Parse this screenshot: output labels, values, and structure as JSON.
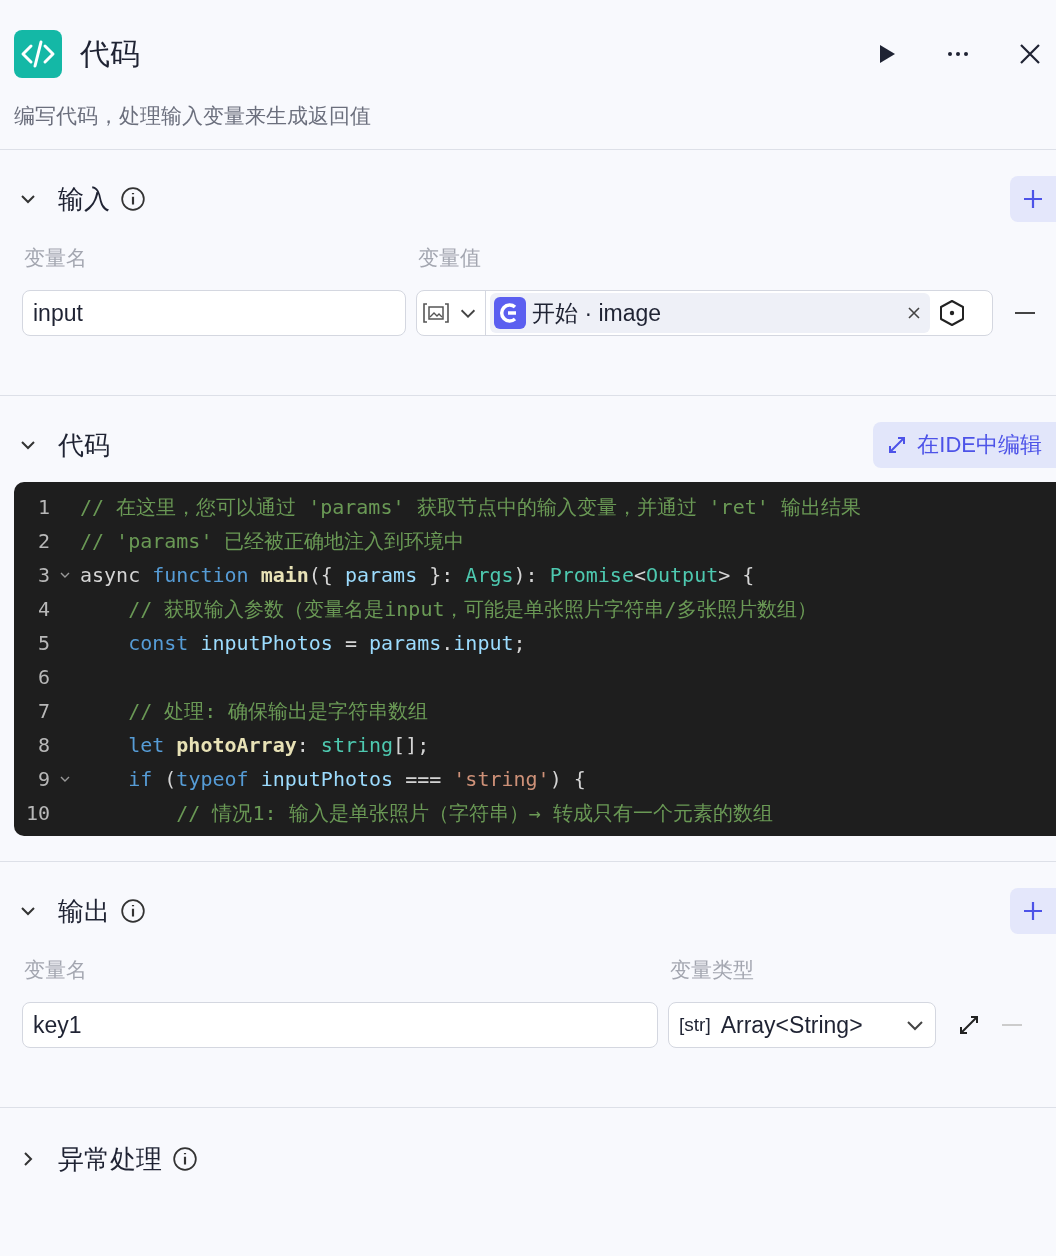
{
  "header": {
    "title": "代码",
    "description": "编写代码，处理输入变量来生成返回值"
  },
  "input_section": {
    "title": "输入",
    "expanded": true,
    "columns": [
      "变量名",
      "变量值"
    ],
    "rows": [
      {
        "name": "input",
        "kind": "image",
        "ref_source": "开始 · image"
      }
    ]
  },
  "code_section": {
    "title": "代码",
    "expanded": true,
    "ide_button": "在IDE中编辑",
    "lines": [
      {
        "number": "1",
        "foldable": false,
        "tokens": [
          {
            "kind": "comment",
            "text": "// 在这里，您可以通过 'params' 获取节点中的输入变量，并通过 'ret' 输出结果"
          }
        ]
      },
      {
        "number": "2",
        "foldable": false,
        "tokens": [
          {
            "kind": "comment",
            "text": "// 'params' 已经被正确地注入到环境中"
          }
        ]
      },
      {
        "number": "3",
        "foldable": true,
        "tokens": [
          {
            "kind": "plain",
            "text": "async "
          },
          {
            "kind": "keyword",
            "text": "function "
          },
          {
            "kind": "func",
            "text": "main"
          },
          {
            "kind": "plain",
            "text": "({ "
          },
          {
            "kind": "var",
            "text": "params"
          },
          {
            "kind": "plain",
            "text": " }: "
          },
          {
            "kind": "type",
            "text": "Args"
          },
          {
            "kind": "plain",
            "text": "): "
          },
          {
            "kind": "type",
            "text": "Promise"
          },
          {
            "kind": "plain",
            "text": "<"
          },
          {
            "kind": "type",
            "text": "Output"
          },
          {
            "kind": "plain",
            "text": "> {"
          }
        ]
      },
      {
        "number": "4",
        "foldable": false,
        "tokens": [
          {
            "kind": "comment",
            "text": "    // 获取输入参数（变量名是input，可能是单张照片字符串/多张照片数组）"
          }
        ]
      },
      {
        "number": "5",
        "foldable": false,
        "tokens": [
          {
            "kind": "keyword",
            "text": "    const "
          },
          {
            "kind": "var",
            "text": "inputPhotos"
          },
          {
            "kind": "plain",
            "text": " = "
          },
          {
            "kind": "var",
            "text": "params"
          },
          {
            "kind": "plain",
            "text": "."
          },
          {
            "kind": "var",
            "text": "input"
          },
          {
            "kind": "plain",
            "text": ";"
          }
        ]
      },
      {
        "number": "6",
        "foldable": false
      },
      {
        "number": "7",
        "foldable": false,
        "tokens": [
          {
            "kind": "comment",
            "text": "    // 处理: 确保输出是字符串数组"
          }
        ]
      },
      {
        "number": "8",
        "foldable": false,
        "tokens": [
          {
            "kind": "keyword",
            "text": "    let "
          },
          {
            "kind": "func",
            "text": "photoArray"
          },
          {
            "kind": "plain",
            "text": ": "
          },
          {
            "kind": "type",
            "text": "string"
          },
          {
            "kind": "plain",
            "text": "[];"
          }
        ]
      },
      {
        "number": "9",
        "foldable": true,
        "tokens": [
          {
            "kind": "keyword",
            "text": "    if "
          },
          {
            "kind": "plain",
            "text": "("
          },
          {
            "kind": "keyword",
            "text": "typeof "
          },
          {
            "kind": "var",
            "text": "inputPhotos"
          },
          {
            "kind": "plain",
            "text": " === "
          },
          {
            "kind": "string",
            "text": "'string'"
          },
          {
            "kind": "plain",
            "text": ") {"
          }
        ]
      },
      {
        "number": "10",
        "foldable": false,
        "tokens": [
          {
            "kind": "comment",
            "text": "        // 情况1: 输入是单张照片（字符串）→ 转成只有一个元素的数组"
          }
        ]
      }
    ]
  },
  "output_section": {
    "title": "输出",
    "expanded": true,
    "columns": [
      "变量名",
      "变量类型"
    ],
    "rows": [
      {
        "name": "key1",
        "type_tag": "[str]",
        "type": "Array<String>"
      }
    ]
  },
  "exception_section": {
    "title": "异常处理",
    "expanded": false
  }
}
